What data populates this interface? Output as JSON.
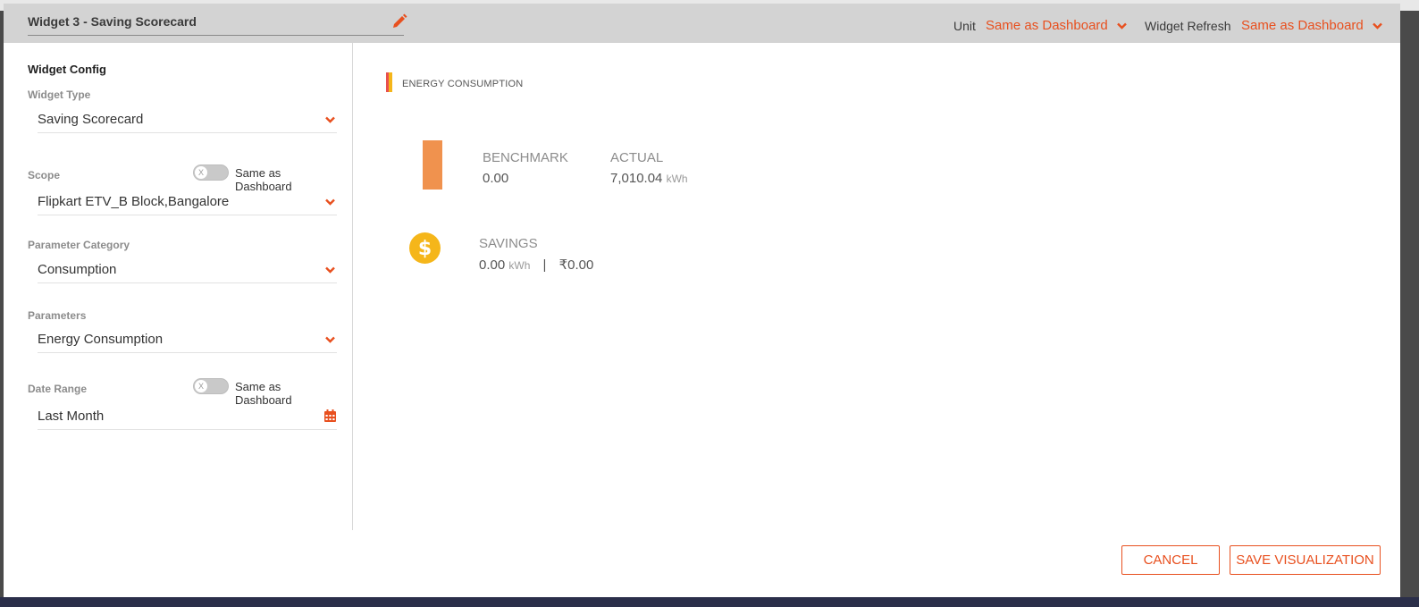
{
  "modal": {
    "title": "Widget 3 - Saving Scorecard",
    "unit_label": "Unit",
    "unit_value": "Same as Dashboard",
    "refresh_label": "Widget Refresh",
    "refresh_value": "Same as Dashboard"
  },
  "config": {
    "section_title": "Widget Config",
    "widget_type": {
      "label": "Widget Type",
      "value": "Saving Scorecard"
    },
    "scope": {
      "label": "Scope",
      "toggle_label": "Same as Dashboard",
      "toggle_on": false,
      "value": "Flipkart ETV_B Block,Bangalore"
    },
    "parameter_category": {
      "label": "Parameter Category",
      "value": "Consumption"
    },
    "parameters": {
      "label": "Parameters",
      "value": "Energy Consumption"
    },
    "date_range": {
      "label": "Date Range",
      "toggle_label": "Same as Dashboard",
      "toggle_on": false,
      "value": "Last Month"
    },
    "toggle_knob": "X"
  },
  "preview": {
    "title": "ENERGY CONSUMPTION",
    "benchmark_label": "BENCHMARK",
    "benchmark_value": "0.00",
    "actual_label": "ACTUAL",
    "actual_value": "7,010.04",
    "actual_unit": "kWh",
    "savings_label": "SAVINGS",
    "savings_value": "0.00",
    "savings_unit": "kWh",
    "separator": "|",
    "savings_money": "₹0.00",
    "dollar_symbol": "$"
  },
  "buttons": {
    "cancel": "CANCEL",
    "save": "SAVE VISUALIZATION"
  },
  "colors": {
    "accent": "#e8501f",
    "header_bg": "#d3d3d3",
    "benchmark_bar": "#f0924e",
    "savings_icon": "#f5b61a"
  },
  "icons": {
    "edit": "pencil-icon",
    "dropdown": "chevron-down-icon",
    "calendar": "calendar-icon",
    "savings": "dollar-circle-icon"
  }
}
